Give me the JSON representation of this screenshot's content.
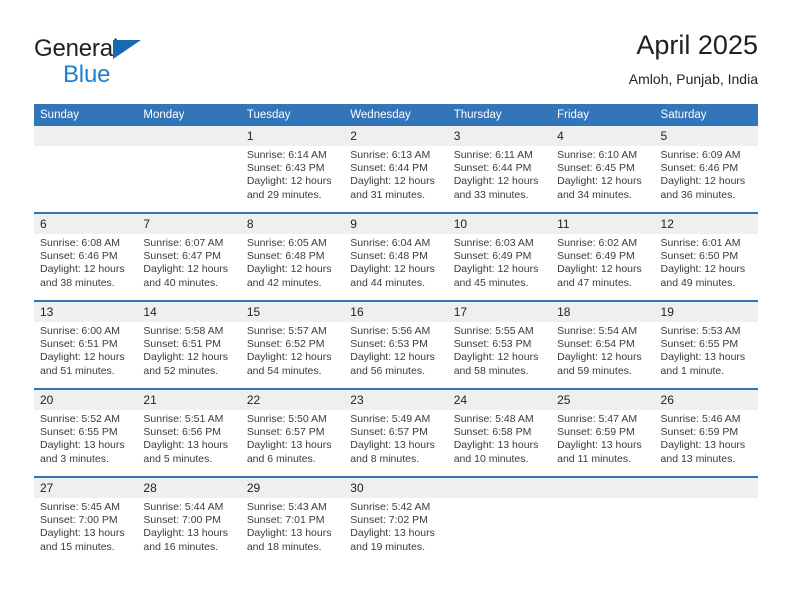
{
  "brand": {
    "name_top": "General",
    "name_bottom": "Blue",
    "triangle_color": "#1769b0",
    "bottom_color": "#1f7fd0"
  },
  "header": {
    "title": "April 2025",
    "subtitle": "Amloh, Punjab, India"
  },
  "theme": {
    "header_blue": "#3275b8",
    "date_band_gray": "#efefef",
    "text_color": "#231f20",
    "detail_text_color": "#3b3b3b"
  },
  "weekday_headers": [
    "Sunday",
    "Monday",
    "Tuesday",
    "Wednesday",
    "Thursday",
    "Friday",
    "Saturday"
  ],
  "weeks": [
    [
      {
        "day": "",
        "sunrise": "",
        "sunset": "",
        "daylight1": "",
        "daylight2": ""
      },
      {
        "day": "",
        "sunrise": "",
        "sunset": "",
        "daylight1": "",
        "daylight2": ""
      },
      {
        "day": "1",
        "sunrise": "Sunrise: 6:14 AM",
        "sunset": "Sunset: 6:43 PM",
        "daylight1": "Daylight: 12 hours",
        "daylight2": "and 29 minutes."
      },
      {
        "day": "2",
        "sunrise": "Sunrise: 6:13 AM",
        "sunset": "Sunset: 6:44 PM",
        "daylight1": "Daylight: 12 hours",
        "daylight2": "and 31 minutes."
      },
      {
        "day": "3",
        "sunrise": "Sunrise: 6:11 AM",
        "sunset": "Sunset: 6:44 PM",
        "daylight1": "Daylight: 12 hours",
        "daylight2": "and 33 minutes."
      },
      {
        "day": "4",
        "sunrise": "Sunrise: 6:10 AM",
        "sunset": "Sunset: 6:45 PM",
        "daylight1": "Daylight: 12 hours",
        "daylight2": "and 34 minutes."
      },
      {
        "day": "5",
        "sunrise": "Sunrise: 6:09 AM",
        "sunset": "Sunset: 6:46 PM",
        "daylight1": "Daylight: 12 hours",
        "daylight2": "and 36 minutes."
      }
    ],
    [
      {
        "day": "6",
        "sunrise": "Sunrise: 6:08 AM",
        "sunset": "Sunset: 6:46 PM",
        "daylight1": "Daylight: 12 hours",
        "daylight2": "and 38 minutes."
      },
      {
        "day": "7",
        "sunrise": "Sunrise: 6:07 AM",
        "sunset": "Sunset: 6:47 PM",
        "daylight1": "Daylight: 12 hours",
        "daylight2": "and 40 minutes."
      },
      {
        "day": "8",
        "sunrise": "Sunrise: 6:05 AM",
        "sunset": "Sunset: 6:48 PM",
        "daylight1": "Daylight: 12 hours",
        "daylight2": "and 42 minutes."
      },
      {
        "day": "9",
        "sunrise": "Sunrise: 6:04 AM",
        "sunset": "Sunset: 6:48 PM",
        "daylight1": "Daylight: 12 hours",
        "daylight2": "and 44 minutes."
      },
      {
        "day": "10",
        "sunrise": "Sunrise: 6:03 AM",
        "sunset": "Sunset: 6:49 PM",
        "daylight1": "Daylight: 12 hours",
        "daylight2": "and 45 minutes."
      },
      {
        "day": "11",
        "sunrise": "Sunrise: 6:02 AM",
        "sunset": "Sunset: 6:49 PM",
        "daylight1": "Daylight: 12 hours",
        "daylight2": "and 47 minutes."
      },
      {
        "day": "12",
        "sunrise": "Sunrise: 6:01 AM",
        "sunset": "Sunset: 6:50 PM",
        "daylight1": "Daylight: 12 hours",
        "daylight2": "and 49 minutes."
      }
    ],
    [
      {
        "day": "13",
        "sunrise": "Sunrise: 6:00 AM",
        "sunset": "Sunset: 6:51 PM",
        "daylight1": "Daylight: 12 hours",
        "daylight2": "and 51 minutes."
      },
      {
        "day": "14",
        "sunrise": "Sunrise: 5:58 AM",
        "sunset": "Sunset: 6:51 PM",
        "daylight1": "Daylight: 12 hours",
        "daylight2": "and 52 minutes."
      },
      {
        "day": "15",
        "sunrise": "Sunrise: 5:57 AM",
        "sunset": "Sunset: 6:52 PM",
        "daylight1": "Daylight: 12 hours",
        "daylight2": "and 54 minutes."
      },
      {
        "day": "16",
        "sunrise": "Sunrise: 5:56 AM",
        "sunset": "Sunset: 6:53 PM",
        "daylight1": "Daylight: 12 hours",
        "daylight2": "and 56 minutes."
      },
      {
        "day": "17",
        "sunrise": "Sunrise: 5:55 AM",
        "sunset": "Sunset: 6:53 PM",
        "daylight1": "Daylight: 12 hours",
        "daylight2": "and 58 minutes."
      },
      {
        "day": "18",
        "sunrise": "Sunrise: 5:54 AM",
        "sunset": "Sunset: 6:54 PM",
        "daylight1": "Daylight: 12 hours",
        "daylight2": "and 59 minutes."
      },
      {
        "day": "19",
        "sunrise": "Sunrise: 5:53 AM",
        "sunset": "Sunset: 6:55 PM",
        "daylight1": "Daylight: 13 hours",
        "daylight2": "and 1 minute."
      }
    ],
    [
      {
        "day": "20",
        "sunrise": "Sunrise: 5:52 AM",
        "sunset": "Sunset: 6:55 PM",
        "daylight1": "Daylight: 13 hours",
        "daylight2": "and 3 minutes."
      },
      {
        "day": "21",
        "sunrise": "Sunrise: 5:51 AM",
        "sunset": "Sunset: 6:56 PM",
        "daylight1": "Daylight: 13 hours",
        "daylight2": "and 5 minutes."
      },
      {
        "day": "22",
        "sunrise": "Sunrise: 5:50 AM",
        "sunset": "Sunset: 6:57 PM",
        "daylight1": "Daylight: 13 hours",
        "daylight2": "and 6 minutes."
      },
      {
        "day": "23",
        "sunrise": "Sunrise: 5:49 AM",
        "sunset": "Sunset: 6:57 PM",
        "daylight1": "Daylight: 13 hours",
        "daylight2": "and 8 minutes."
      },
      {
        "day": "24",
        "sunrise": "Sunrise: 5:48 AM",
        "sunset": "Sunset: 6:58 PM",
        "daylight1": "Daylight: 13 hours",
        "daylight2": "and 10 minutes."
      },
      {
        "day": "25",
        "sunrise": "Sunrise: 5:47 AM",
        "sunset": "Sunset: 6:59 PM",
        "daylight1": "Daylight: 13 hours",
        "daylight2": "and 11 minutes."
      },
      {
        "day": "26",
        "sunrise": "Sunrise: 5:46 AM",
        "sunset": "Sunset: 6:59 PM",
        "daylight1": "Daylight: 13 hours",
        "daylight2": "and 13 minutes."
      }
    ],
    [
      {
        "day": "27",
        "sunrise": "Sunrise: 5:45 AM",
        "sunset": "Sunset: 7:00 PM",
        "daylight1": "Daylight: 13 hours",
        "daylight2": "and 15 minutes."
      },
      {
        "day": "28",
        "sunrise": "Sunrise: 5:44 AM",
        "sunset": "Sunset: 7:00 PM",
        "daylight1": "Daylight: 13 hours",
        "daylight2": "and 16 minutes."
      },
      {
        "day": "29",
        "sunrise": "Sunrise: 5:43 AM",
        "sunset": "Sunset: 7:01 PM",
        "daylight1": "Daylight: 13 hours",
        "daylight2": "and 18 minutes."
      },
      {
        "day": "30",
        "sunrise": "Sunrise: 5:42 AM",
        "sunset": "Sunset: 7:02 PM",
        "daylight1": "Daylight: 13 hours",
        "daylight2": "and 19 minutes."
      },
      {
        "day": "",
        "sunrise": "",
        "sunset": "",
        "daylight1": "",
        "daylight2": ""
      },
      {
        "day": "",
        "sunrise": "",
        "sunset": "",
        "daylight1": "",
        "daylight2": ""
      },
      {
        "day": "",
        "sunrise": "",
        "sunset": "",
        "daylight1": "",
        "daylight2": ""
      }
    ]
  ]
}
